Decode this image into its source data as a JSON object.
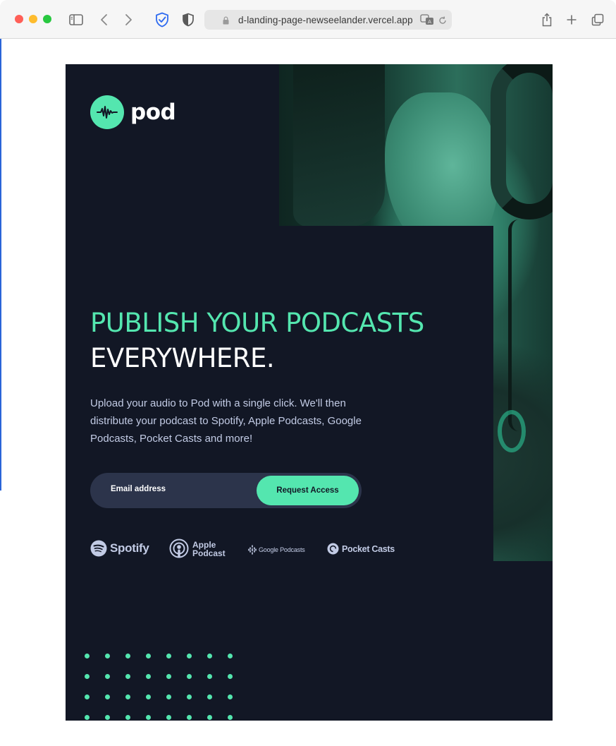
{
  "browser": {
    "url": "d-landing-page-newseelander.vercel.app",
    "traffic_lights": [
      "#ff5f57",
      "#febc2e",
      "#28c840"
    ]
  },
  "brand": {
    "name": "pod",
    "accent": "#54e6af",
    "background": "#121725"
  },
  "hero": {
    "headline_highlight": "PUBLISH YOUR PODCASTS",
    "headline_rest": "EVERYWHERE.",
    "description": "Upload your audio to Pod with a single click. We'll then distribute your podcast to Spotify, Apple Podcasts, Google Podcasts, Pocket Casts and more!"
  },
  "form": {
    "email_placeholder": "Email address",
    "submit_label": "Request Access"
  },
  "platforms": {
    "spotify": "Spotify",
    "apple_line1": "Apple",
    "apple_line2": "Podcast",
    "google": "Google Podcasts",
    "pocket": "Pocket Casts"
  },
  "icons": [
    "sidebar-icon",
    "back-icon",
    "forward-icon",
    "shield-check-icon",
    "privacy-icon",
    "lock-icon",
    "translate-icon",
    "reload-icon",
    "share-icon",
    "new-tab-icon",
    "tabs-icon"
  ]
}
